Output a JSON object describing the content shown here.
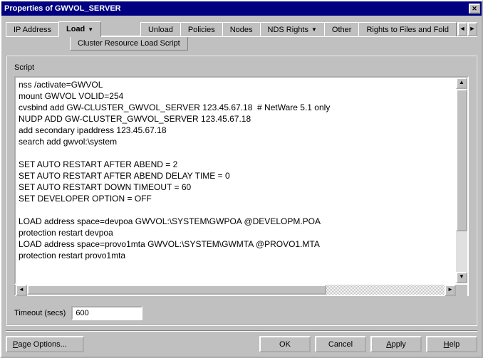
{
  "window": {
    "title": "Properties of GWVOL_SERVER"
  },
  "tabs": {
    "ip_address": "IP Address",
    "load": "Load",
    "unload": "Unload",
    "policies": "Policies",
    "nodes": "Nodes",
    "nds_rights": "NDS Rights",
    "other": "Other",
    "rights_files": "Rights to Files and Fold"
  },
  "subtab": {
    "label": "Cluster Resource Load Script"
  },
  "script": {
    "label": "Script",
    "text": "nss /activate=GWVOL\nmount GWVOL VOLID=254\ncvsbind add GW-CLUSTER_GWVOL_SERVER 123.45.67.18  # NetWare 5.1 only\nNUDP ADD GW-CLUSTER_GWVOL_SERVER 123.45.67.18\nadd secondary ipaddress 123.45.67.18\nsearch add gwvol:\\system\n\nSET AUTO RESTART AFTER ABEND = 2\nSET AUTO RESTART AFTER ABEND DELAY TIME = 0\nSET AUTO RESTART DOWN TIMEOUT = 60\nSET DEVELOPER OPTION = OFF\n\nLOAD address space=devpoa GWVOL:\\SYSTEM\\GWPOA @DEVELOPM.POA\nprotection restart devpoa\nLOAD address space=provo1mta GWVOL:\\SYSTEM\\GWMTA @PROVO1.MTA\nprotection restart provo1mta"
  },
  "timeout": {
    "label": "Timeout (secs)",
    "value": "600"
  },
  "buttons": {
    "page_options": "Page Options...",
    "ok": "OK",
    "cancel": "Cancel",
    "apply": "Apply",
    "help": "Help"
  }
}
